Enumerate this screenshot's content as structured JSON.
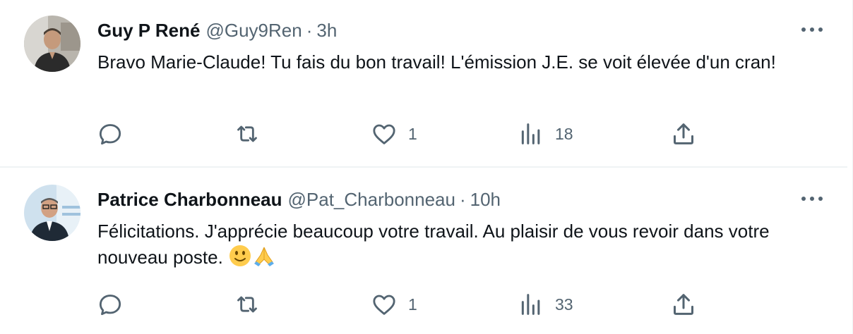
{
  "tweets": [
    {
      "name": "Guy P René",
      "handle": "@Guy9Ren",
      "separator": "·",
      "time": "3h",
      "text": "Bravo Marie-Claude! Tu fais du bon travail! L'émission J.E. se voit élevée d'un cran!",
      "emojis": [],
      "replies": "",
      "retweets": "",
      "likes": "1",
      "views": "18",
      "icons": [
        "more-icon",
        "reply-icon",
        "retweet-icon",
        "like-icon",
        "views-icon",
        "share-icon"
      ]
    },
    {
      "name": "Patrice Charbonneau",
      "handle": "@Pat_Charbonneau",
      "separator": "·",
      "time": "10h",
      "text": "Félicitations. J'apprécie beaucoup votre travail. Au plaisir de vous revoir dans votre nouveau poste.",
      "emojis": [
        "slightly-smiling-face",
        "folded-hands"
      ],
      "replies": "",
      "retweets": "",
      "likes": "1",
      "views": "33",
      "icons": [
        "more-icon",
        "reply-icon",
        "retweet-icon",
        "like-icon",
        "views-icon",
        "share-icon"
      ]
    }
  ],
  "colors": {
    "text_primary": "#0f1419",
    "text_secondary": "#536471",
    "divider": "#eff3f4"
  }
}
